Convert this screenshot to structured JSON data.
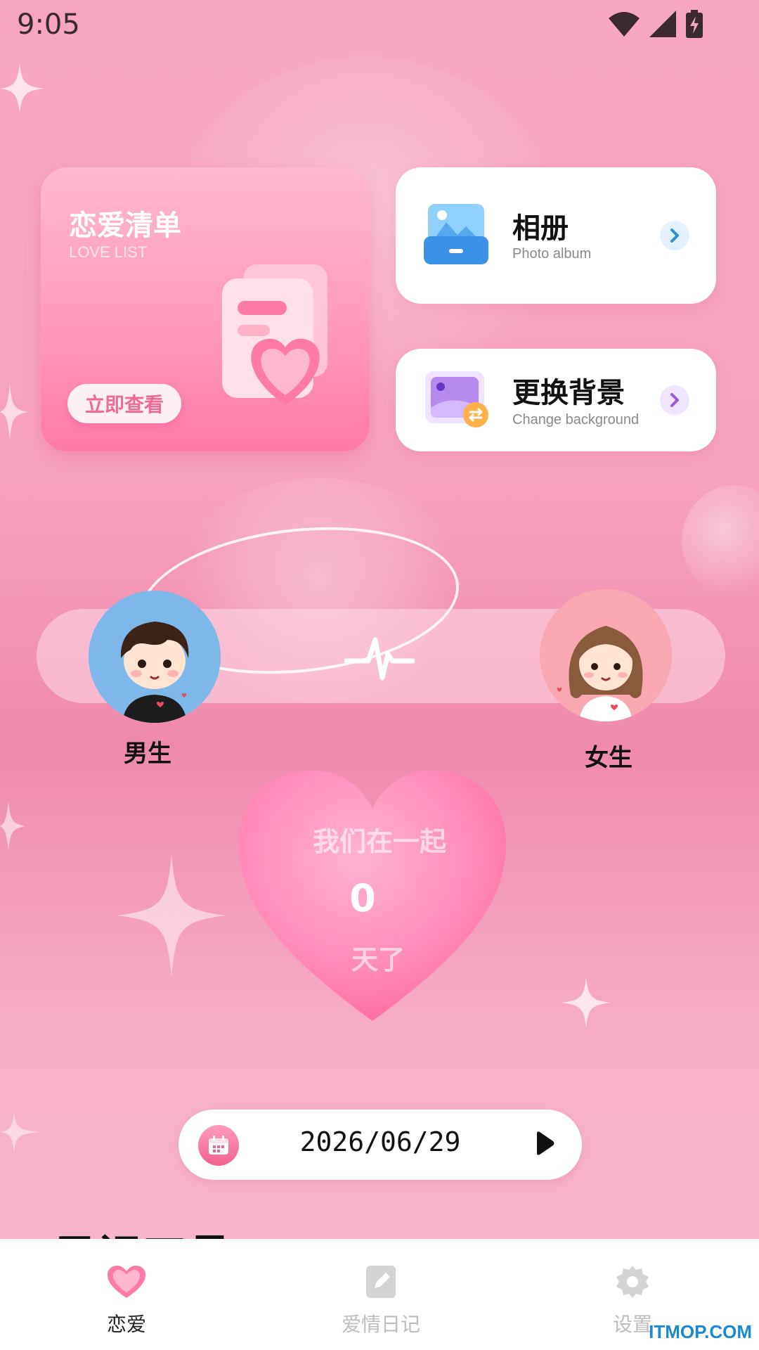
{
  "status_bar": {
    "time": "9:05",
    "icons": [
      "wifi-icon",
      "signal-icon",
      "battery-charging-icon"
    ]
  },
  "love_list": {
    "title": "恋爱清单",
    "subtitle": "LOVE LIST",
    "button_label": "立即查看"
  },
  "album_card": {
    "title": "相册",
    "subtitle": "Photo album",
    "icon": "photo-album-icon",
    "chevron_color": "#2f8fd8"
  },
  "background_card": {
    "title": "更换背景",
    "subtitle": "Change background",
    "icon": "change-background-icon",
    "chevron_color": "#9b59e0"
  },
  "couple": {
    "boy_label": "男生",
    "girl_label": "女生",
    "boy_avatar_bg": "#7eb8ea",
    "girl_avatar_bg": "#f9a7b0"
  },
  "together": {
    "line1": "我们在一起",
    "days": "0",
    "line2": "天了"
  },
  "date_picker": {
    "date": "2026/06/29",
    "icon": "calendar-icon"
  },
  "section_peek": {
    "title": "日记工具"
  },
  "bottom_nav": {
    "items": [
      {
        "label": "恋爱",
        "icon": "heart-icon",
        "active": true
      },
      {
        "label": "爱情日记",
        "icon": "diary-icon",
        "active": false
      },
      {
        "label": "设置",
        "icon": "gear-icon",
        "active": false
      }
    ],
    "active_color": "#222222",
    "inactive_color": "#bdbdbd",
    "accent": "#ff7aa8"
  },
  "watermark": "ITMOP.COM"
}
